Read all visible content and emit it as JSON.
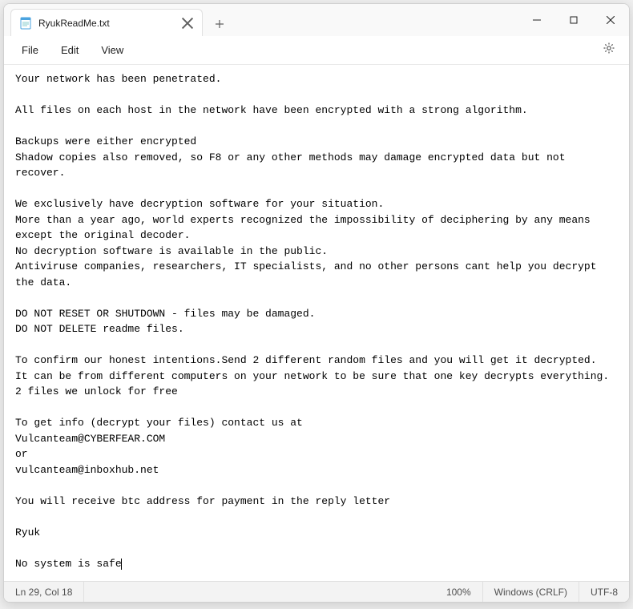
{
  "tab": {
    "title": "RyukReadMe.txt"
  },
  "menu": {
    "file": "File",
    "edit": "Edit",
    "view": "View"
  },
  "document": {
    "text": "Your network has been penetrated.\n\nAll files on each host in the network have been encrypted with a strong algorithm.\n\nBackups were either encrypted\nShadow copies also removed, so F8 or any other methods may damage encrypted data but not recover.\n\nWe exclusively have decryption software for your situation.\nMore than a year ago, world experts recognized the impossibility of deciphering by any means except the original decoder.\nNo decryption software is available in the public.\nAntiviruse companies, researchers, IT specialists, and no other persons cant help you decrypt the data.\n\nDO NOT RESET OR SHUTDOWN - files may be damaged.\nDO NOT DELETE readme files.\n\nTo confirm our honest intentions.Send 2 different random files and you will get it decrypted.\nIt can be from different computers on your network to be sure that one key decrypts everything.\n2 files we unlock for free\n\nTo get info (decrypt your files) contact us at\nVulcanteam@CYBERFEAR.COM\nor\nvulcanteam@inboxhub.net\n\nYou will receive btc address for payment in the reply letter\n\nRyuk\n\nNo system is safe"
  },
  "status": {
    "position": "Ln 29, Col 18",
    "zoom": "100%",
    "line_ending": "Windows (CRLF)",
    "encoding": "UTF-8"
  }
}
